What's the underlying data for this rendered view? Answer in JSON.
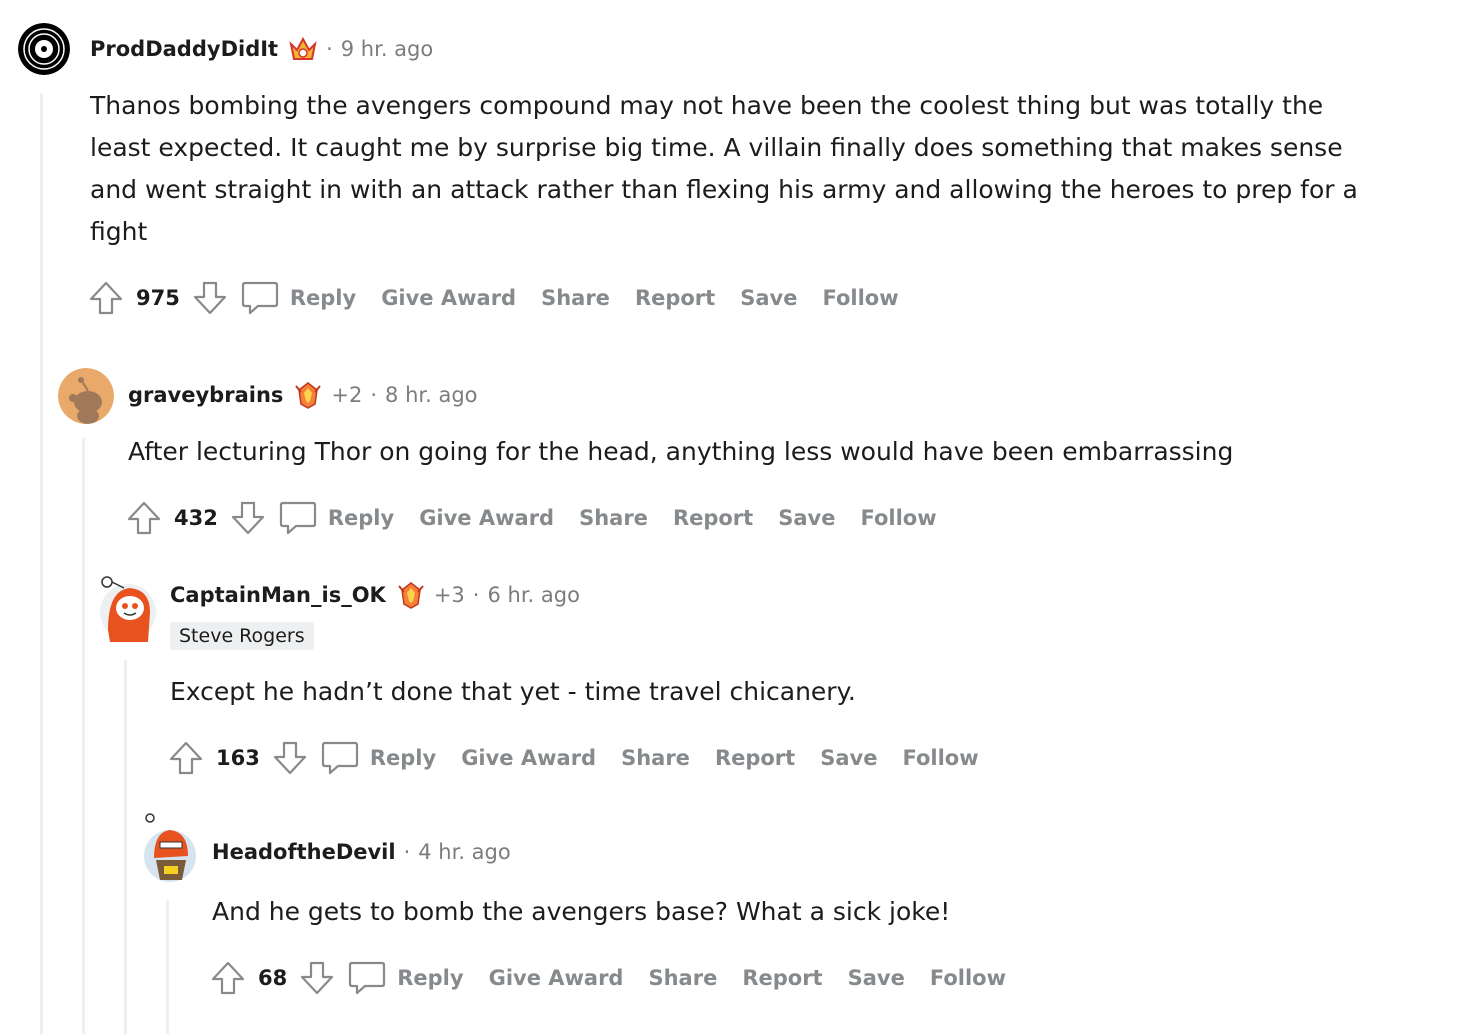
{
  "comments": [
    {
      "username": "ProdDaddyDidIt",
      "award": "wearing-is-caring-crown-icon",
      "award_count": "",
      "time": "9 hr. ago",
      "flair": "",
      "body": "Thanos bombing the avengers compound may not have been the coolest thing but was totally the least expected. It caught me by surprise big time. A villain finally does something that makes sense and went straight in with an attack rather than flexing his army and allowing the heroes to prep for a fight",
      "score": "975"
    },
    {
      "username": "graveybrains",
      "award": "fire-crystal-award-icon",
      "award_count": "+2",
      "time": "8 hr. ago",
      "flair": "",
      "body": "After lecturing Thor on going for the head, anything less would have been embarrassing",
      "score": "432"
    },
    {
      "username": "CaptainMan_is_OK",
      "award": "fire-crystal-award-icon",
      "award_count": "+3",
      "time": "6 hr. ago",
      "flair": "Steve Rogers",
      "body": "Except he hadn’t done that yet - time travel chicanery.",
      "score": "163"
    },
    {
      "username": "HeadoftheDevil",
      "award": "",
      "award_count": "",
      "time": "4 hr. ago",
      "flair": "",
      "body": "And he gets to bomb the avengers base? What a sick joke!",
      "score": "68"
    }
  ],
  "actions": {
    "reply": "Reply",
    "give_award": "Give Award",
    "share": "Share",
    "report": "Report",
    "save": "Save",
    "follow": "Follow"
  },
  "colors": {
    "thread_line": "#edeff1",
    "action_text": "#878a8c",
    "meta_text": "#7c7c7c",
    "text": "#1c1c1c"
  }
}
